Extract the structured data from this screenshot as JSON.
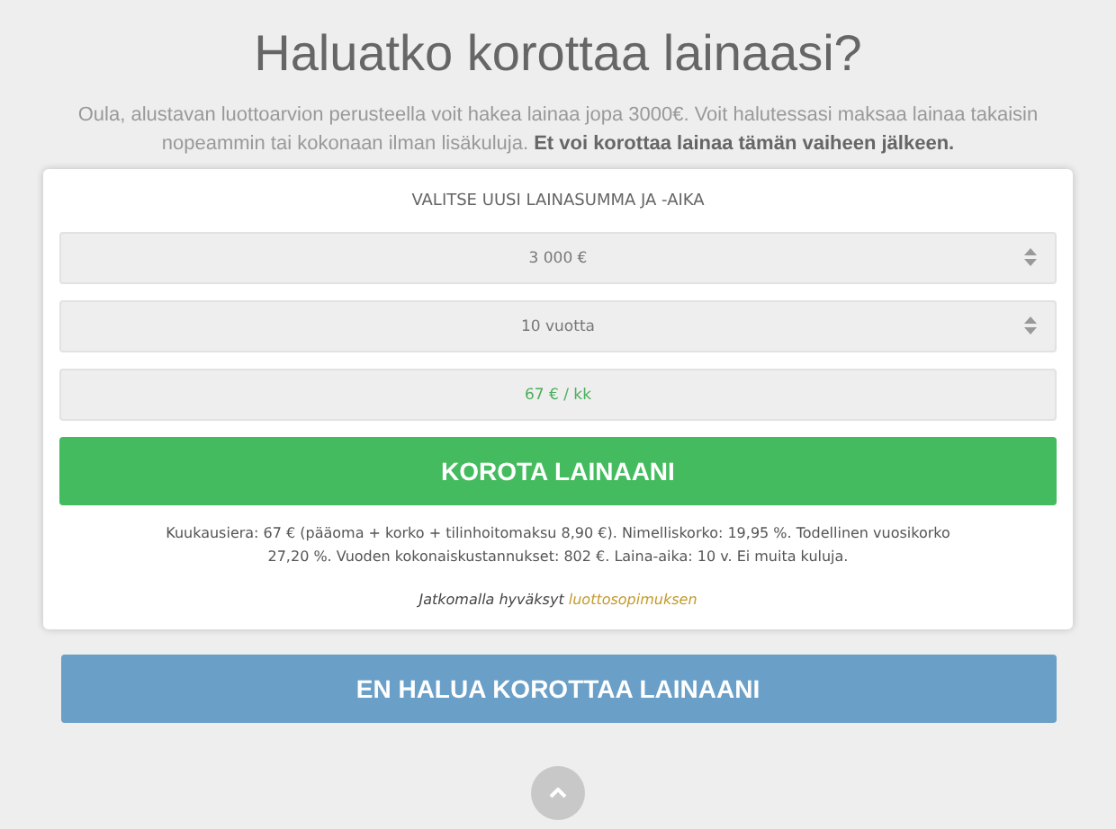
{
  "title": "Haluatko korottaa lainaasi?",
  "intro": "Oula, alustavan luottoarvion perusteella voit hakea lainaa jopa 3000€. Voit halutessasi maksaa lainaa takaisin nopeammin tai kokonaan ilman lisäkuluja. **Et voi korottaa lainaa tämän vaiheen jälkeen.**",
  "card": {
    "heading": "VALITSE UUSI LAINASUMMA JA -AIKA",
    "fields": [
      {
        "kind": "select",
        "value": "3 000 €"
      },
      {
        "kind": "select",
        "value": "10 vuotta"
      },
      {
        "kind": "result",
        "value": "67 € / kk"
      }
    ],
    "submit_button": "KOROTA LAINAANI",
    "terms": "Kuukausiera: 67 € (pääoma + korko + tilinhoitomaksu 8,90 €). Nimelliskorko: 19,95 %. Todellinen vuosikorko 27,20 %. Vuoden kokonaiskustannukset: 802 €. Laina-aika: 10 v. Ei muita kuluja.",
    "consent": {
      "text": "Jatkomalla hyväksyt",
      "link": "luottosopimuksen"
    }
  },
  "decline_button": "EN HALUA KOROTTAA LAINAANI"
}
